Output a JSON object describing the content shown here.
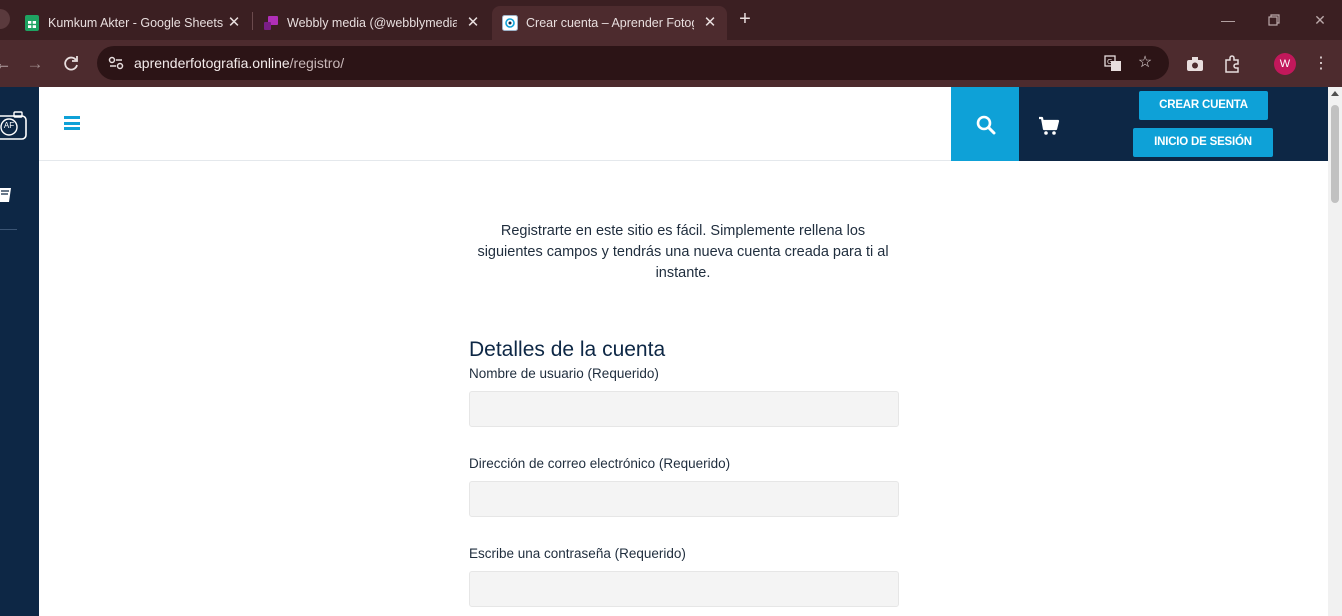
{
  "browser": {
    "tabs": [
      {
        "title": "Kumkum Akter - Google Sheets",
        "icon": "google-sheets-icon",
        "active": false
      },
      {
        "title": "Webbly media (@webblymedia",
        "icon": "webbly-icon",
        "active": false
      },
      {
        "title": "Crear cuenta – Aprender Fotogr",
        "icon": "site-favicon",
        "active": true
      }
    ],
    "url_host": "aprenderfotografia.online",
    "url_path": "/registro/",
    "profile_initial": "W"
  },
  "header": {
    "create_account_label": "CREAR CUENTA",
    "login_label": "INICIO DE SESIÓN",
    "logo_text": "AF"
  },
  "main": {
    "intro": "Registrarte en este sitio es fácil. Simplemente rellena los siguientes campos y tendrás una nueva cuenta creada para ti al instante.",
    "section_title": "Detalles de la cuenta",
    "fields": [
      {
        "label": "Nombre de usuario (Requerido)",
        "value": ""
      },
      {
        "label": "Dirección de correo electrónico (Requerido)",
        "value": ""
      },
      {
        "label": "Escribe una contraseña (Requerido)",
        "value": ""
      }
    ]
  },
  "colors": {
    "accent": "#0ea1d7",
    "navy": "#0d2745",
    "chrome_dark": "#3b1f22",
    "chrome_toolbar": "#4d2b2e"
  }
}
